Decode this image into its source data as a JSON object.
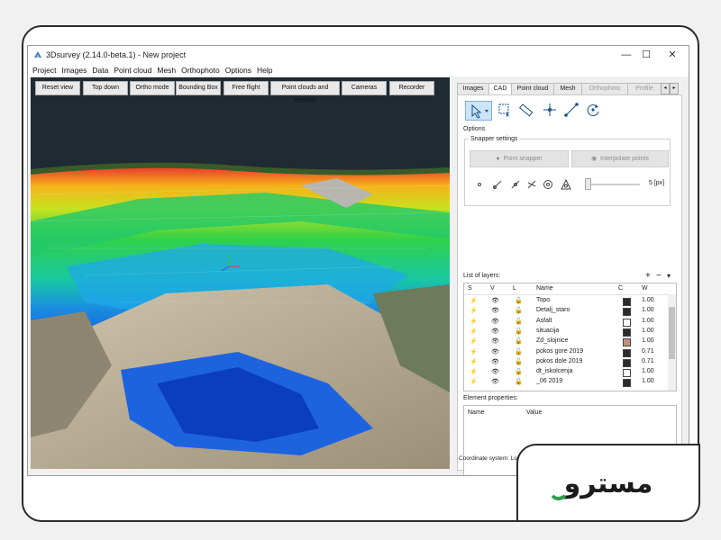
{
  "window": {
    "title": "3Dsurvey (2.14.0-beta.1) - New project",
    "minimize_glyph": "—",
    "maximize_glyph": "☐",
    "close_glyph": "✕"
  },
  "menu": [
    "Project",
    "Images",
    "Data",
    "Point cloud",
    "Mesh",
    "Orthophoto",
    "Options",
    "Help"
  ],
  "viewport": {
    "buttons": [
      "Reset view",
      "Top down",
      "Ortho mode",
      "Bounding Box",
      "Free flight",
      "Point clouds and meshes",
      "Cameras",
      "Recorder"
    ]
  },
  "panel": {
    "tabs": [
      "Images",
      "CAD",
      "Point cloud",
      "Mesh",
      "Orthophoto",
      "Profile"
    ],
    "active_tab": "CAD",
    "tab_scroll_left": "◂",
    "tab_scroll_right": "▸",
    "tools": [
      "select-pointer-icon",
      "select-rectangle-icon",
      "measure-ruler-icon",
      "crosshair-point-icon",
      "line-icon",
      "rotate-icon"
    ],
    "options_label": "Options",
    "snapper_label": "Snapper settings",
    "point_snapper": "Point snapper",
    "interpolate_points": "Interpolate points",
    "snap_size": "5 [px]",
    "layers_label": "List of layers:",
    "add_glyph": "+",
    "remove_glyph": "−",
    "more_glyph": "▾",
    "layer_columns": [
      "S",
      "V",
      "L",
      "Name",
      "C",
      "W"
    ],
    "layers": [
      {
        "name": "Topo",
        "color": "#2b2b2b",
        "width": "1.00"
      },
      {
        "name": "Detalj_staro",
        "color": "#2b2b2b",
        "width": "1.00"
      },
      {
        "name": "Asfalt",
        "color": "#ffffff",
        "width": "1.00"
      },
      {
        "name": "situacija",
        "color": "#2b2b2b",
        "width": "1.00"
      },
      {
        "name": "Zd_slojnice",
        "color": "#c09080",
        "width": "1.00"
      },
      {
        "name": "pokos gore 2019",
        "color": "#2b2b2b",
        "width": "0.71"
      },
      {
        "name": "pokos dole 2019",
        "color": "#2b2b2b",
        "width": "0.71"
      },
      {
        "name": "dt_iskolcenja",
        "color": "#ffffff",
        "width": "1.00"
      },
      {
        "name": "_06 2019",
        "color": "#2b2b2b",
        "width": "1.00"
      }
    ],
    "element_properties_label": "Element properties:",
    "prop_columns": [
      "Name",
      "Value"
    ],
    "coordinate_system": "Coordinate system: Lo"
  },
  "brand": {
    "text": "مسترو",
    "color_green": "#2f9e4d",
    "color_dark": "#1b1b1b"
  }
}
